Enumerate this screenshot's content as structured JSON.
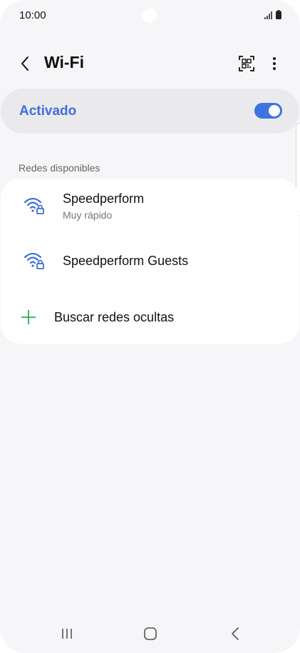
{
  "status_bar": {
    "time": "10:00"
  },
  "header": {
    "title": "Wi-Fi",
    "back_icon": "chevron-left-icon",
    "qr_icon": "qr-code-scan-icon",
    "more_icon": "more-vertical-icon"
  },
  "wifi_toggle": {
    "label": "Activado",
    "on": true
  },
  "available": {
    "section_title": "Redes disponibles",
    "networks": [
      {
        "name": "Speedperform",
        "subtitle": "Muy rápido",
        "icon": "wifi-locked-icon"
      },
      {
        "name": "Speedperform Guests",
        "subtitle": "",
        "icon": "wifi-locked-icon"
      }
    ],
    "add_network_label": "Buscar redes ocultas"
  },
  "colors": {
    "accent": "#3e6fd8",
    "toggle_on": "#3e74e0",
    "plus_green": "#2fa84f",
    "background": "#f6f6f8"
  }
}
